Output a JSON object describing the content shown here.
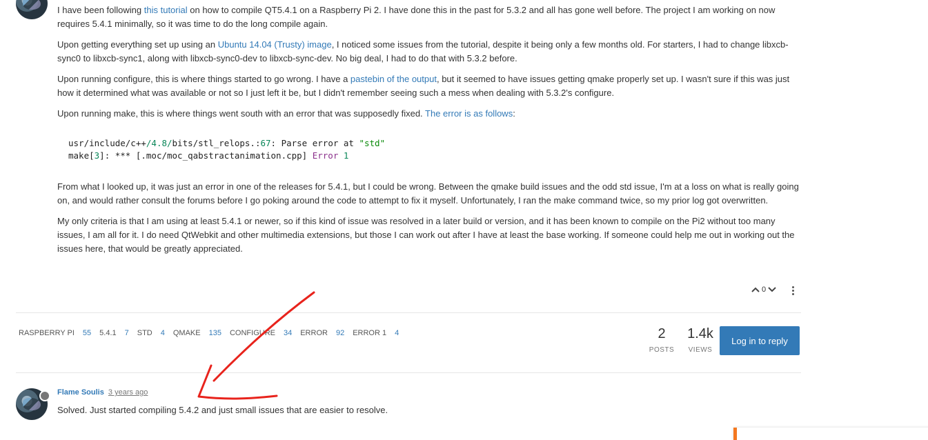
{
  "post": {
    "p1": {
      "before": "I have been following ",
      "link": "this tutorial",
      "after": " on how to compile QT5.4.1 on a Raspberry Pi 2. I have done this in the past for 5.3.2 and all has gone well before. The project I am working on now requires 5.4.1 minimally, so it was time to do the long compile again."
    },
    "p2": {
      "before": "Upon getting everything set up using an ",
      "link": "Ubuntu 14.04 (Trusty) image",
      "after": ", I noticed some issues from the tutorial, despite it being only a few months old. For starters, I had to change libxcb-sync0 to libxcb-sync1, along with libxcb-sync0-dev to libxcb-sync-dev. No big deal, I had to do that with 5.3.2 before."
    },
    "p3": {
      "before": "Upon running configure, this is where things started to go wrong. I have a ",
      "link": "pastebin of the output",
      "after": ", but it seemed to have issues getting qmake properly set up. I wasn't sure if this was just how it determined what was available or not so I just left it be, but I didn't remember seeing such a mess when dealing with 5.3.2's configure."
    },
    "p4": {
      "before": "Upon running make, this is where things went south with an error that was supposedly fixed. ",
      "link": "The error is as follows",
      "after": ":"
    },
    "code": {
      "l1_a": "usr/include/c++",
      "l1_b": "/4.8/",
      "l1_c": "bits/stl_relops.:",
      "l1_d": "67",
      "l1_e": ": Parse error at ",
      "l1_f": "\"std\"",
      "l2_a": "make[",
      "l2_b": "3",
      "l2_c": "]: *** [.moc/moc_qabstractanimation.cpp] ",
      "l2_d": "Error",
      "l2_e": " ",
      "l2_f": "1"
    },
    "p5": "From what I looked up, it was just an error in one of the releases for 5.4.1, but I could be wrong. Between the qmake build issues and the odd std issue, I'm at a loss on what is really going on, and would rather consult the forums before I go poking around the code to attempt to fix it myself. Unfortunately, I ran the make command twice, so my prior log got overwritten.",
    "p6": "My only criteria is that I am using at least 5.4.1 or newer, so if this kind of issue was resolved in a later build or version, and it has been known to compile on the Pi2 without too many issues, I am all for it. I do need QtWebkit and other multimedia extensions, but those I can work out after I have at least the base working. If someone could help me out in working out the issues here, that would be greatly appreciated.",
    "votes": "0"
  },
  "tags": [
    {
      "name": "raspberry pi",
      "count": "55"
    },
    {
      "name": "5.4.1",
      "count": "7"
    },
    {
      "name": "std",
      "count": "4"
    },
    {
      "name": "qmake",
      "count": "135"
    },
    {
      "name": "configure",
      "count": "34"
    },
    {
      "name": "error",
      "count": "92"
    },
    {
      "name": "error 1",
      "count": "4"
    }
  ],
  "stats": {
    "posts_value": "2",
    "posts_label": "POSTS",
    "views_value": "1.4k",
    "views_label": "VIEWS"
  },
  "reply_button": "Log in to reply",
  "reply": {
    "author": "Flame Soulis",
    "time": "3 years ago",
    "text": "Solved. Just started compiling 5.4.2 and just small issues that are easier to resolve."
  },
  "colors": {
    "link": "#337ab7",
    "button": "#337ab7",
    "annotation": "#e8231c",
    "accent_orange": "#f47820"
  }
}
